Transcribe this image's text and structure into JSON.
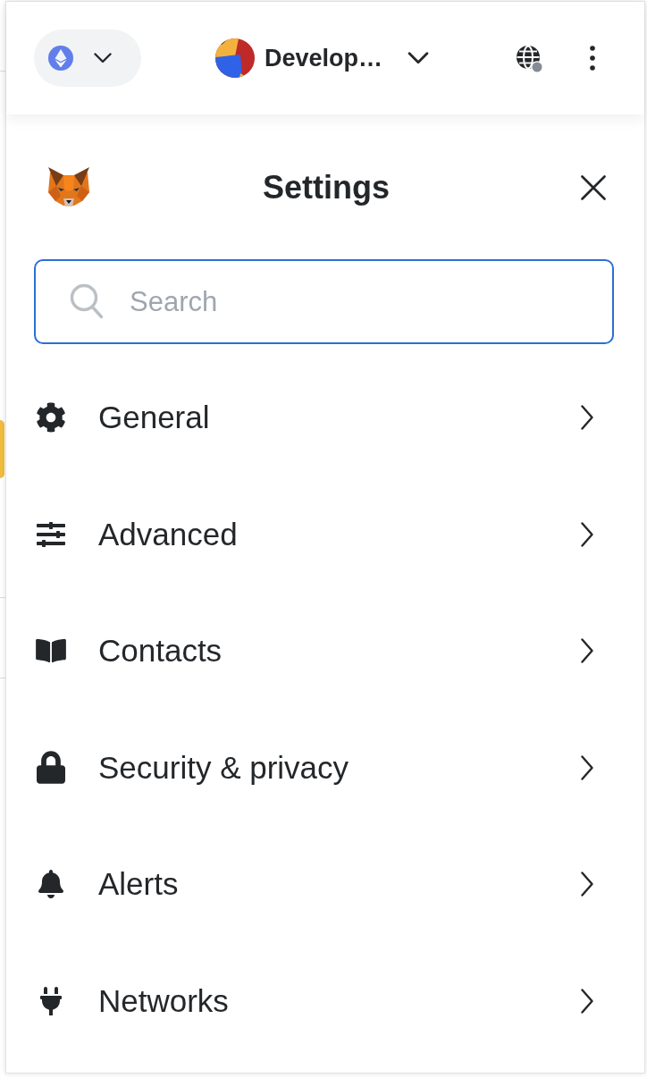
{
  "top_bar": {
    "account_name": "Develop…"
  },
  "settings": {
    "title": "Settings",
    "search": {
      "placeholder": "Search"
    },
    "items": [
      {
        "kind": "general",
        "label": "General"
      },
      {
        "kind": "advanced",
        "label": "Advanced"
      },
      {
        "kind": "contacts",
        "label": "Contacts"
      },
      {
        "kind": "security",
        "label": "Security & privacy"
      },
      {
        "kind": "alerts",
        "label": "Alerts"
      },
      {
        "kind": "networks",
        "label": "Networks"
      }
    ]
  }
}
